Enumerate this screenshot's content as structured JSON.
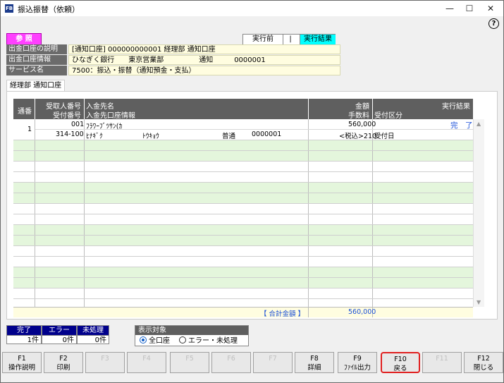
{
  "window": {
    "app_icon": "FB",
    "title": "振込振替（依頼）",
    "minimize": "—",
    "maximize": "☐",
    "close": "✕",
    "help": "?"
  },
  "mode_badge": "参 照",
  "status": {
    "before": "実行前",
    "separator": "|",
    "result": "実行結果",
    "result_color": "#00ffff"
  },
  "info": [
    {
      "label": "出金口座の説明",
      "value": "[通知口座] 000000000001 経理部 通知口座"
    },
    {
      "label": "出金口座情報",
      "value": "ひなぎく銀行　　東京営業部　　　　　通知　　　0000001"
    },
    {
      "label": "サービス名",
      "value": "7500：振込・振替（通知預金・支払）"
    }
  ],
  "tab": {
    "label": "経理部 通知口座"
  },
  "grid": {
    "headers": {
      "seq": "通番",
      "recv_no": "受取人番号",
      "accept_no": "受付番号",
      "payee_name": "入金先名",
      "payee_account": "入金先口座情報",
      "amount": "金額",
      "fee": "手数料",
      "result": "実行結果",
      "accept_class": "受付区分"
    },
    "rows": [
      {
        "seq": "1",
        "recv_no": "001",
        "accept_no": "314-100",
        "payee_name": "ﾌﾗﾜｰﾌﾞﾂｻﾝ(ｶ",
        "bank": "ﾋﾅｷﾞｸ",
        "branch": "ﾄｳｷｮｳ",
        "acct_type": "普通",
        "acct_no": "0000001",
        "amount": "560,000",
        "fee": "<税込>210",
        "result": "完　了",
        "accept_class": "受付日"
      }
    ],
    "total_label": "【 合計金額 】",
    "total_value": "560,000"
  },
  "summary": {
    "done_label": "完了",
    "error_label": "エラー",
    "pending_label": "未処理",
    "done_value": "1件",
    "error_value": "0件",
    "pending_value": "0件"
  },
  "filter": {
    "title": "表示対象",
    "options": [
      "全口座",
      "エラー・未処理"
    ],
    "selected": "全口座"
  },
  "fkeys": [
    {
      "key": "F1",
      "label": "操作説明",
      "enabled": true
    },
    {
      "key": "F2",
      "label": "印刷",
      "enabled": true
    },
    {
      "key": "F3",
      "label": "",
      "enabled": false
    },
    {
      "key": "F4",
      "label": "",
      "enabled": false
    },
    {
      "key": "F5",
      "label": "",
      "enabled": false
    },
    {
      "key": "F6",
      "label": "",
      "enabled": false
    },
    {
      "key": "F7",
      "label": "",
      "enabled": false
    },
    {
      "key": "F8",
      "label": "詳細",
      "enabled": true
    },
    {
      "key": "F9",
      "label": "ﾌｧｲﾙ出力",
      "enabled": true
    },
    {
      "key": "F10",
      "label": "戻る",
      "enabled": true
    },
    {
      "key": "F11",
      "label": "",
      "enabled": false
    },
    {
      "key": "F12",
      "label": "閉じる",
      "enabled": true
    }
  ]
}
